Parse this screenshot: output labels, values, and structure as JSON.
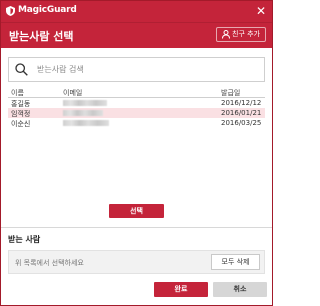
{
  "app": {
    "title": "MagicGuard",
    "close_glyph": "✕"
  },
  "header": {
    "title": "받는사람 선택",
    "add_friend_label": "친구 추가"
  },
  "search": {
    "placeholder": "받는사람 검색"
  },
  "table": {
    "columns": [
      "이름",
      "이메일",
      "발급일"
    ],
    "rows": [
      {
        "name": "홍길동",
        "email": "",
        "date": "2016/12/12",
        "selected": false
      },
      {
        "name": "임꺽정",
        "email": "",
        "date": "2016/01/21",
        "selected": true
      },
      {
        "name": "이순신",
        "email": "",
        "date": "2016/03/25",
        "selected": false
      }
    ]
  },
  "select_button_label": "선택",
  "recipients": {
    "label": "받는 사람",
    "placeholder": "위 목록에서 선택하세요",
    "delete_all_label": "모두 삭제"
  },
  "footer": {
    "ok_label": "완료",
    "cancel_label": "취소"
  },
  "colors": {
    "accent": "#c4243a",
    "selected_row": "#fae0e3"
  },
  "icons": {
    "app": "magicguard-logo-icon",
    "close": "close-icon",
    "add_friend": "person-icon",
    "search": "search-icon"
  }
}
